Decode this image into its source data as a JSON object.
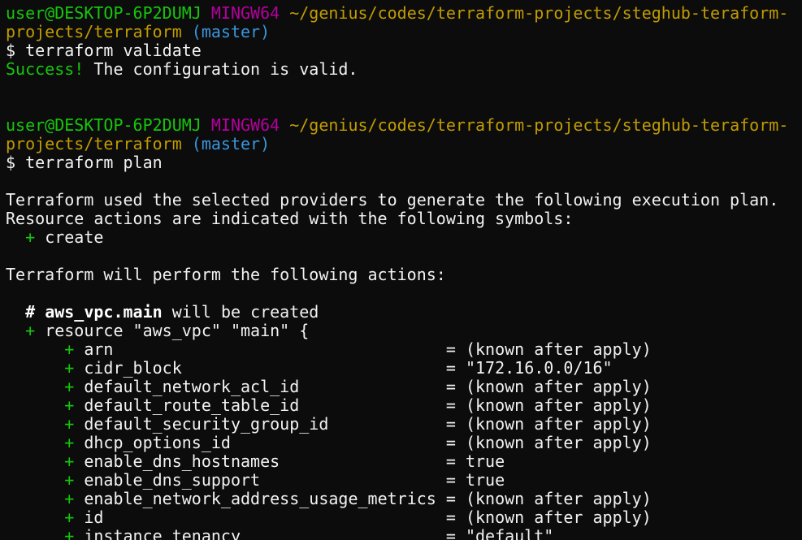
{
  "prompt": {
    "user_host": "user@DESKTOP-6P2DUMJ",
    "system": "MINGW64",
    "path_line1": "~/genius/codes/terraform-projects/steghub-teraform-",
    "path_line2": "projects/terraform",
    "branch": "(master)",
    "dollar": "$"
  },
  "commands": {
    "validate": "terraform validate",
    "plan": "terraform plan"
  },
  "validate_output": {
    "success_word": "Success!",
    "message": " The configuration is valid."
  },
  "plan_output": {
    "intro1": "Terraform used the selected providers to generate the following execution plan.",
    "intro2": "Resource actions are indicated with the following symbols:",
    "symbol_plus": "+",
    "symbol_label": "create",
    "perform": "Terraform will perform the following actions:",
    "resource_hash": "#",
    "resource_addr": "aws_vpc.main",
    "resource_created": "will be created",
    "resource_decl": "resource \"aws_vpc\" \"main\" {"
  },
  "attributes": [
    {
      "name": "arn",
      "value": "(known after apply)"
    },
    {
      "name": "cidr_block",
      "value": "\"172.16.0.0/16\""
    },
    {
      "name": "default_network_acl_id",
      "value": "(known after apply)"
    },
    {
      "name": "default_route_table_id",
      "value": "(known after apply)"
    },
    {
      "name": "default_security_group_id",
      "value": "(known after apply)"
    },
    {
      "name": "dhcp_options_id",
      "value": "(known after apply)"
    },
    {
      "name": "enable_dns_hostnames",
      "value": "true"
    },
    {
      "name": "enable_dns_support",
      "value": "true"
    },
    {
      "name": "enable_network_address_usage_metrics",
      "value": "(known after apply)"
    },
    {
      "name": "id",
      "value": "(known after apply)"
    },
    {
      "name": "instance_tenancy",
      "value": "\"default\""
    }
  ]
}
